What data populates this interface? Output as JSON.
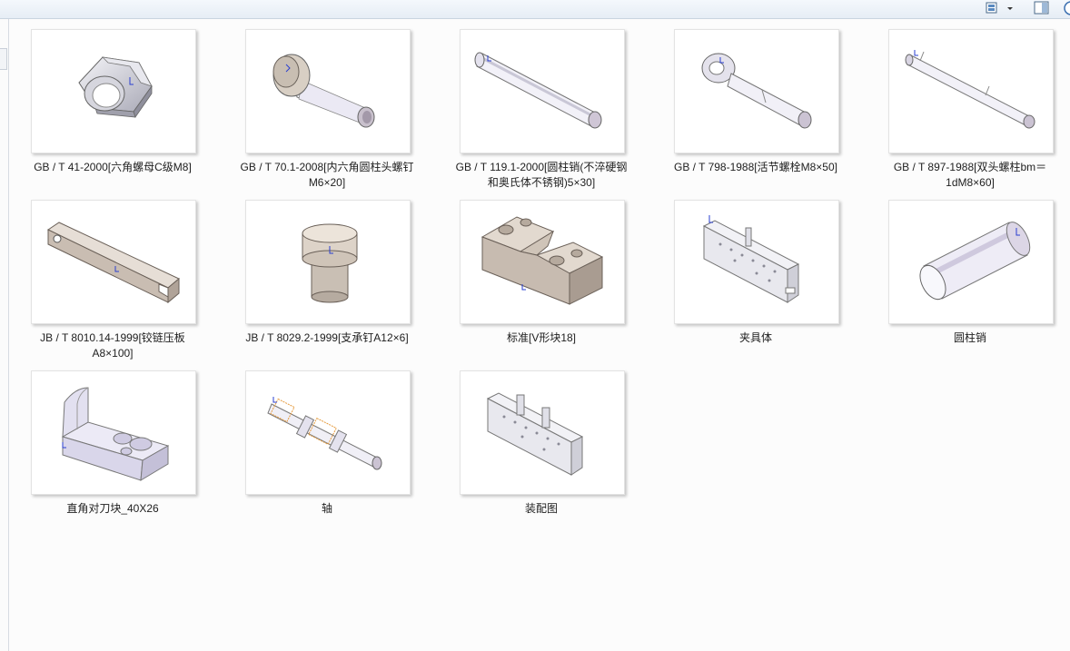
{
  "toolbar": {
    "views_icon": "views-icon",
    "dropdown_icon": "chevron-down-icon",
    "preview_pane_icon": "preview-pane-icon",
    "help_icon": "help-icon"
  },
  "files": [
    {
      "name": "GB / T 41-2000[六角螺母C级M8]",
      "thumb": "hex-nut"
    },
    {
      "name": "GB / T 70.1-2008[内六角圆柱头螺钉M6×20]",
      "thumb": "socket-screw"
    },
    {
      "name": "GB / T 119.1-2000[圆柱销(不淬硬钢和奥氏体不锈钢)5×30]",
      "thumb": "dowel-pin"
    },
    {
      "name": "GB / T 798-1988[活节螺栓M8×50]",
      "thumb": "eye-bolt"
    },
    {
      "name": "GB / T 897-1988[双头螺柱bm＝1dM8×60]",
      "thumb": "stud"
    },
    {
      "name": "JB / T 8010.14-1999[铰链压板A8×100]",
      "thumb": "hinge-plate"
    },
    {
      "name": "JB / T 8029.2-1999[支承钉A12×6]",
      "thumb": "support-pin"
    },
    {
      "name": "标准[V形块18]",
      "thumb": "v-block"
    },
    {
      "name": "夹具体",
      "thumb": "fixture-body"
    },
    {
      "name": "圆柱销",
      "thumb": "cylinder-pin"
    },
    {
      "name": "直角对刀块_40X26",
      "thumb": "setting-block"
    },
    {
      "name": "轴",
      "thumb": "shaft"
    },
    {
      "name": "装配图",
      "thumb": "assembly"
    }
  ]
}
